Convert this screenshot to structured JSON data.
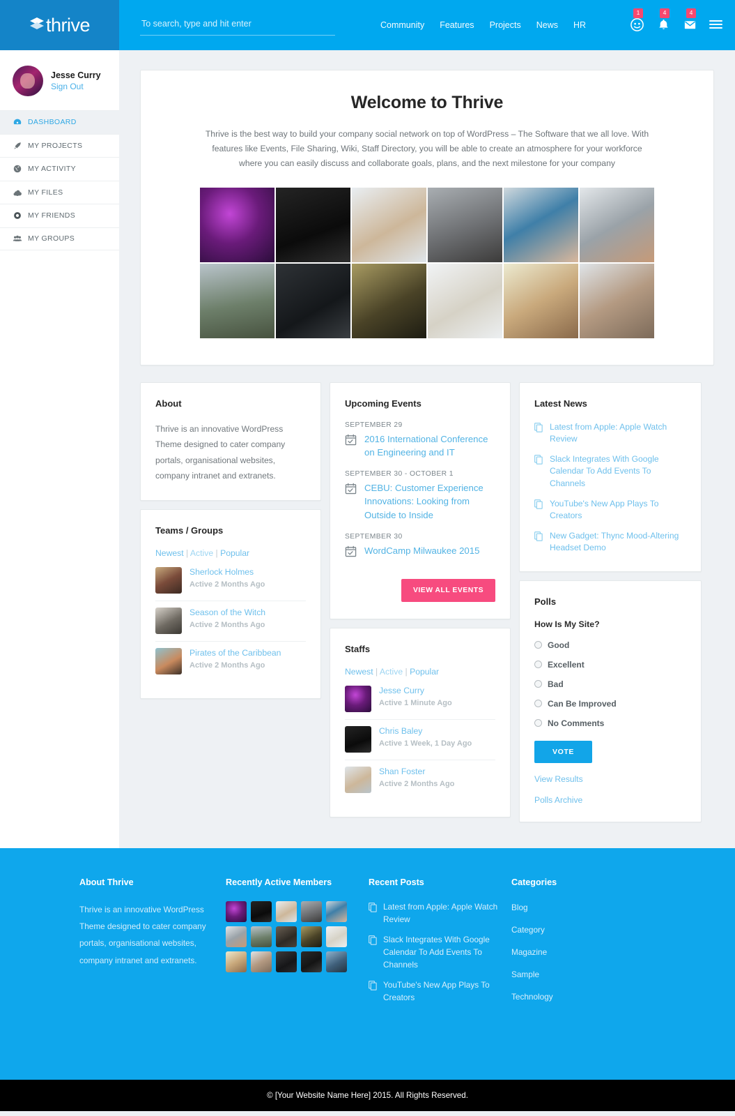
{
  "header": {
    "logo_text": "thrive",
    "logo_icon": "diamond-logo-icon",
    "search_placeholder": "To search, type and hit enter",
    "search_value": "",
    "nav": [
      {
        "label": "Community"
      },
      {
        "label": "Features"
      },
      {
        "label": "Projects"
      },
      {
        "label": "News"
      },
      {
        "label": "HR"
      }
    ],
    "icons": [
      {
        "name": "friends-icon",
        "badge": "1"
      },
      {
        "name": "notifications-bell-icon",
        "badge": "4"
      },
      {
        "name": "messages-envelope-icon",
        "badge": "4"
      }
    ],
    "menu_icon": "hamburger-menu-icon"
  },
  "sidebar": {
    "profile": {
      "name": "Jesse Curry",
      "signout_label": "Sign Out"
    },
    "items": [
      {
        "label": "DASHBOARD",
        "icon": "dashboard-icon",
        "active": true
      },
      {
        "label": "MY PROJECTS",
        "icon": "rocket-icon",
        "active": false
      },
      {
        "label": "MY ACTIVITY",
        "icon": "globe-icon",
        "active": false
      },
      {
        "label": "MY FILES",
        "icon": "cloud-icon",
        "active": false
      },
      {
        "label": "MY FRIENDS",
        "icon": "circle-icon",
        "active": false
      },
      {
        "label": "MY GROUPS",
        "icon": "group-icon",
        "active": false
      }
    ]
  },
  "welcome": {
    "title": "Welcome to Thrive",
    "description": "Thrive is the best way to build your company social network on top of WordPress – The Software that we all love. With features like Events, File Sharing, Wiki, Staff Directory, you will be able to create an atmosphere for your workforce where you can easily discuss and collaborate goals, plans, and the next milestone for your company",
    "photos": [
      "dj-woman-purple",
      "man-tuxedo",
      "woman-thumbs-up",
      "woman-short-hair",
      "woman-blue-beanie",
      "man-grey-shirt",
      "man-backpack-binoculars",
      "woman-chalkboard",
      "man-night-car",
      "woman-blonde-white",
      "friends-selfie",
      "child-camera"
    ]
  },
  "about": {
    "title": "About",
    "body": "Thrive is an innovative WordPress Theme designed to cater company portals, organisational websites, company intranet and extranets."
  },
  "teams": {
    "title": "Teams / Groups",
    "filters": [
      "Newest",
      "Active",
      "Popular"
    ],
    "items": [
      {
        "name": "Sherlock Holmes",
        "meta": "Active 2 Months Ago",
        "thumb": "group-selfie-thumb"
      },
      {
        "name": "Season of the Witch",
        "meta": "Active 2 Months Ago",
        "thumb": "bearded-man-thumb"
      },
      {
        "name": "Pirates of the Caribbean",
        "meta": "Active 2 Months Ago",
        "thumb": "pirates-thumb"
      }
    ]
  },
  "events": {
    "title": "Upcoming Events",
    "items": [
      {
        "date": "SEPTEMBER 29",
        "title": "2016 International Conference on Engineering and IT",
        "icon": "calendar-check-icon"
      },
      {
        "date": "SEPTEMBER 30 - OCTOBER 1",
        "title": "CEBU: Customer Experience Innovations: Looking from Outside to Inside",
        "icon": "calendar-check-icon"
      },
      {
        "date": "SEPTEMBER 30",
        "title": "WordCamp Milwaukee 2015",
        "icon": "calendar-check-icon"
      }
    ],
    "button_label": "VIEW ALL EVENTS"
  },
  "staffs": {
    "title": "Staffs",
    "filters": [
      "Newest",
      "Active",
      "Popular"
    ],
    "items": [
      {
        "name": "Jesse Curry",
        "meta": "Active 1 Minute Ago",
        "thumb": "dj-woman-thumb"
      },
      {
        "name": "Chris Baley",
        "meta": "Active 1 Week, 1 Day Ago",
        "thumb": "tuxedo-man-thumb"
      },
      {
        "name": "Shan Foster",
        "meta": "Active 2 Months Ago",
        "thumb": "thumbsup-woman-thumb"
      }
    ]
  },
  "news": {
    "title": "Latest News",
    "items": [
      {
        "title": "Latest from Apple: Apple Watch Review",
        "icon": "copy-page-icon"
      },
      {
        "title": "Slack Integrates With Google Calendar To Add Events To Channels",
        "icon": "copy-page-icon"
      },
      {
        "title": "YouTube's New App Plays To Creators",
        "icon": "copy-page-icon"
      },
      {
        "title": "New Gadget: Thync Mood-Altering Headset Demo",
        "icon": "copy-page-icon"
      }
    ]
  },
  "polls": {
    "title": "Polls",
    "question": "How Is My Site?",
    "options": [
      {
        "label": "Good"
      },
      {
        "label": "Excellent"
      },
      {
        "label": "Bad"
      },
      {
        "label": "Can Be Improved"
      },
      {
        "label": "No Comments"
      }
    ],
    "vote_label": "VOTE",
    "view_results_label": "View Results",
    "archive_label": "Polls Archive"
  },
  "footer": {
    "about": {
      "title": "About Thrive",
      "body": "Thrive is an innovative WordPress Theme designed to cater company portals, organisational websites, company intranet and extranets."
    },
    "members": {
      "title": "Recently Active Members",
      "avatars": [
        "dj-woman",
        "tuxedo-man",
        "thumbsup-woman",
        "short-hair-woman",
        "beanie-woman",
        "grey-shirt-man",
        "backpack-man",
        "chalkboard-woman",
        "night-car-man",
        "blonde-woman",
        "friends-group",
        "camera-child",
        "dark-hair-woman",
        "bw-woman",
        "blue-shirt-woman"
      ]
    },
    "posts": {
      "title": "Recent Posts",
      "items": [
        {
          "title": "Latest from Apple: Apple Watch Review",
          "icon": "copy-page-icon"
        },
        {
          "title": "Slack Integrates With Google Calendar To Add Events To Channels",
          "icon": "copy-page-icon"
        },
        {
          "title": "YouTube's New App Plays To Creators",
          "icon": "copy-page-icon"
        }
      ]
    },
    "categories": {
      "title": "Categories",
      "items": [
        {
          "label": "Blog"
        },
        {
          "label": "Category"
        },
        {
          "label": "Magazine"
        },
        {
          "label": "Sample"
        },
        {
          "label": "Technology"
        }
      ]
    },
    "copyright": "© [Your Website Name Here] 2015. All Rights Reserved."
  },
  "colors": {
    "brand_blue": "#00a8ef",
    "logo_blue": "#1484c8",
    "accent_pink": "#f74b7f",
    "badge_pink": "#f7486f",
    "link_blue": "#6fc0ec",
    "vote_blue": "#12a5e8",
    "footer_blue": "#0fa7ec",
    "page_bg": "#eef1f4",
    "copyright_bg": "#000000"
  }
}
